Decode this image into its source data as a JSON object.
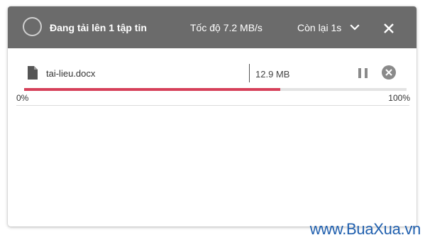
{
  "header": {
    "title": "Đang tải lên 1 tập tin",
    "speed": "Tốc độ 7.2 MB/s",
    "remaining": "Còn lại 1s"
  },
  "icons": {
    "spinner": "circle-progress-icon",
    "expand": "chevron-down-icon",
    "close": "close-icon",
    "file": "file-icon",
    "pause": "pause-icon",
    "cancel": "cancel-circle-icon"
  },
  "upload": {
    "file_name": "tai-lieu.docx",
    "file_size": "12.9 MB",
    "progress_fraction": 0.67,
    "label_start": "0%",
    "label_end": "100%"
  },
  "colors": {
    "header_bg": "#6b6b6b",
    "progress": "#d6405a",
    "track": "#e3e3e3",
    "watermark": "#1f5fae"
  },
  "watermark": "www.BuaXua.vn"
}
